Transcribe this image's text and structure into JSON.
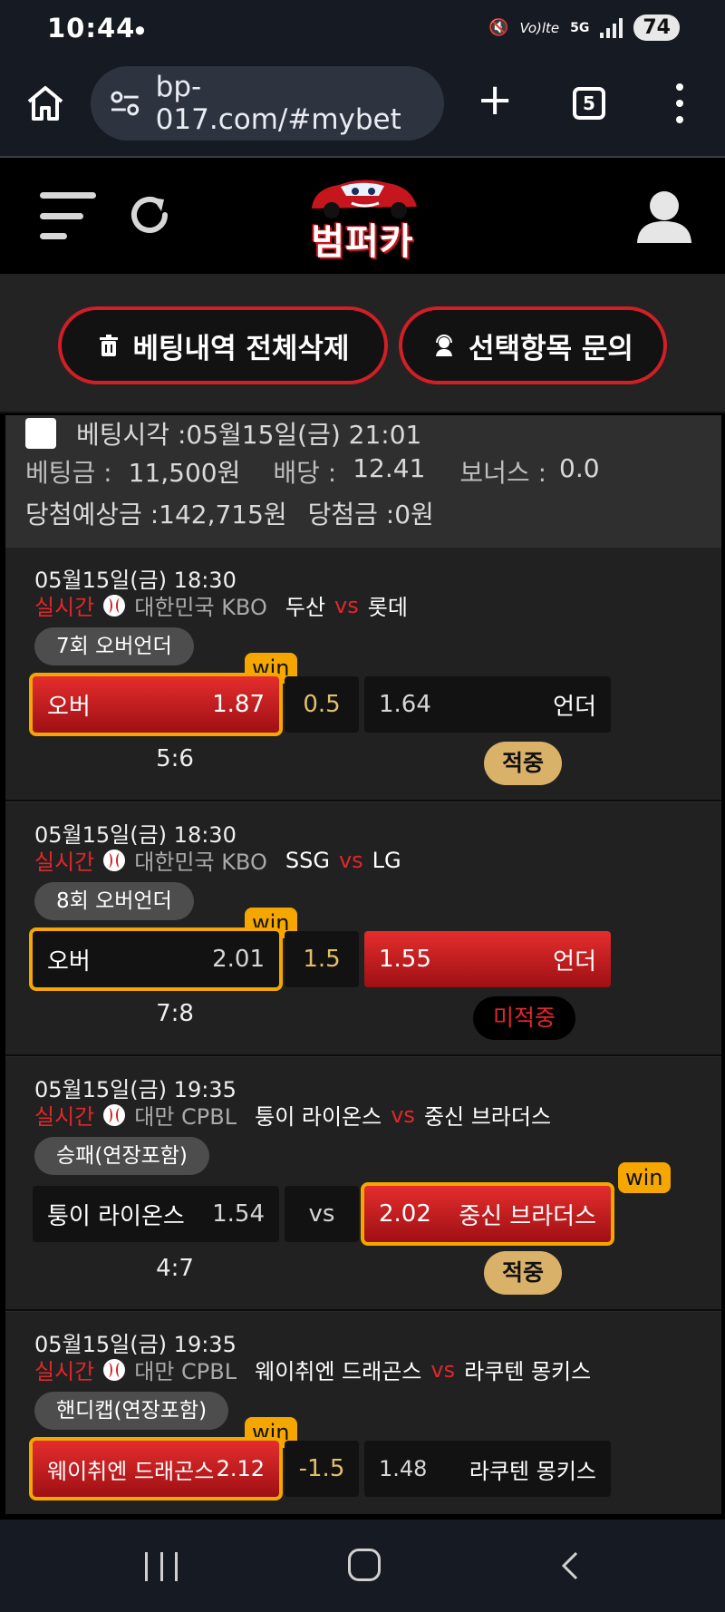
{
  "status_bar": {
    "time": "10:44",
    "net": "5G",
    "volte": "Vo)lte",
    "battery": "74"
  },
  "browser": {
    "url": "bp-017.com/#mybet",
    "tab_count": "5",
    "new_tab_label": "+"
  },
  "site": {
    "logo_text": "범퍼카"
  },
  "actions": {
    "delete_all": "베팅내역 전체삭제",
    "inquire_selected": "선택항목 문의"
  },
  "bet_summary": {
    "bet_time": "베팅시각 :05월15일(금) 21:01",
    "stake_label": "베팅금 :",
    "stake_value": "11,500원",
    "odds_label": "배당 :",
    "odds_value": "12.41",
    "bonus_label": "보너스 :",
    "bonus_value": "0.0",
    "expected_label": "당첨예상금 :142,715원",
    "winnings_label": "당첨금 :0원"
  },
  "matches": [
    {
      "date": "05월15일(금) 18:30",
      "live": "실시간",
      "league": "대한민국 KBO",
      "home": "두산",
      "vs": "vs",
      "away": "롯데",
      "market": "7회 오버언더",
      "left_name": "오버",
      "left_odd": "1.87",
      "mid": "0.5",
      "right_odd": "1.64",
      "right_name": "언더",
      "win_tag": "win",
      "score": "5:6",
      "result": "적중"
    },
    {
      "date": "05월15일(금) 18:30",
      "live": "실시간",
      "league": "대한민국 KBO",
      "home": "SSG",
      "vs": "vs",
      "away": "LG",
      "market": "8회 오버언더",
      "left_name": "오버",
      "left_odd": "2.01",
      "mid": "1.5",
      "right_odd": "1.55",
      "right_name": "언더",
      "win_tag": "win",
      "score": "7:8",
      "result": "미적중"
    },
    {
      "date": "05월15일(금) 19:35",
      "live": "실시간",
      "league": "대만 CPBL",
      "home": "퉁이 라이온스",
      "vs": "vs",
      "away": "중신 브라더스",
      "market": "승패(연장포함)",
      "left_name": "퉁이 라이온스",
      "left_odd": "1.54",
      "mid": "vs",
      "right_odd": "2.02",
      "right_name": "중신 브라더스",
      "win_tag": "win",
      "score": "4:7",
      "result": "적중"
    },
    {
      "date": "05월15일(금) 19:35",
      "live": "실시간",
      "league": "대만 CPBL",
      "home": "웨이취엔 드래곤스",
      "vs": "vs",
      "away": "라쿠텐 몽키스",
      "market": "핸디캡(연장포함)",
      "left_name": "웨이취엔 드래곤스",
      "left_odd": "2.12",
      "mid": "-1.5",
      "right_odd": "1.48",
      "right_name": "라쿠텐 몽키스",
      "win_tag": "win"
    }
  ],
  "colors": {
    "accent_red": "#d11f26",
    "win_gold": "#f5a700",
    "hit_badge": "#d9b169"
  }
}
